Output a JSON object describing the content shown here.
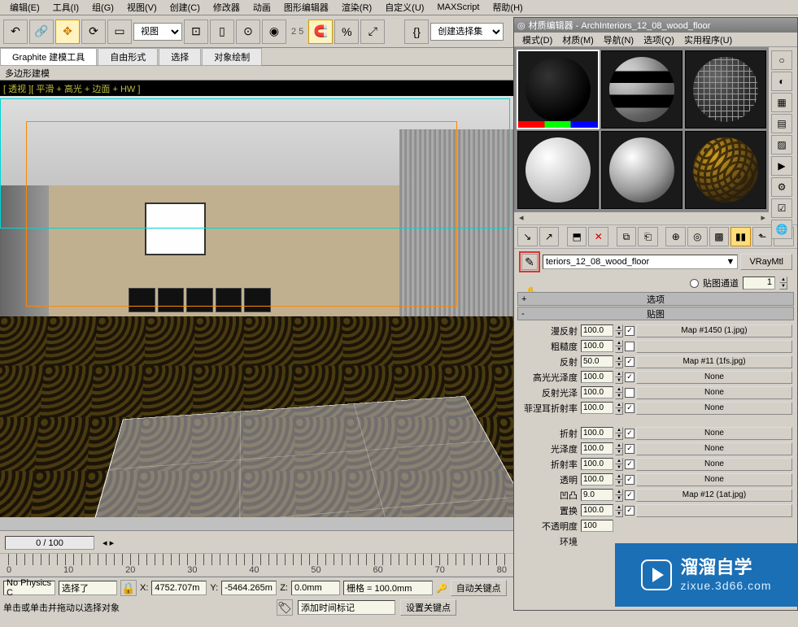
{
  "menus": {
    "m0": "编辑(E)",
    "m1": "工具(I)",
    "m2": "组(G)",
    "m3": "视图(V)",
    "m4": "创建(C)",
    "m5": "修改器",
    "m6": "动画",
    "m7": "图形编辑器",
    "m8": "渲染(R)",
    "m9": "自定义(U)",
    "m10": "MAXScript",
    "m11": "帮助(H)"
  },
  "toolbar": {
    "viewmode": "视图",
    "snap_val": "2 5",
    "create_set": "创建选择集"
  },
  "ribbon": {
    "t0": "Graphite 建模工具",
    "t1": "自由形式",
    "t2": "选择",
    "t3": "对象绘制"
  },
  "sub_ribbon": "多边形建模",
  "viewport": {
    "label": "[ 透视 ][ 平滑 + 高光 + 边面 + HW ]"
  },
  "timeline": {
    "range": "0 / 100",
    "r0": "0",
    "r1": "10",
    "r2": "20",
    "r3": "30",
    "r4": "40",
    "r5": "50",
    "r6": "60",
    "r7": "70",
    "r8": "80"
  },
  "status": {
    "physics": "No Physics C",
    "sel": "选择了",
    "x_lbl": "X:",
    "x": "4752.707m",
    "y_lbl": "Y:",
    "y": "-5464.265m",
    "z_lbl": "Z:",
    "z": "0.0mm",
    "grid": "栅格 = 100.0mm",
    "autokey": "自动关键点",
    "hint": "单击或单击并拖动以选择对象",
    "add_tag": "添加时间标记",
    "setkey": "设置关键点"
  },
  "mat": {
    "title": "材质编辑器 - ArchInteriors_12_08_wood_floor",
    "menu": {
      "m0": "模式(D)",
      "m1": "材质(M)",
      "m2": "导航(N)",
      "m3": "选项(Q)",
      "m4": "实用程序(U)"
    },
    "name": "teriors_12_08_wood_floor",
    "type": "VRayMtl",
    "channel_lbl": "贴图通道",
    "channel_val": "1",
    "roll_options": "选项",
    "roll_maps": "贴图",
    "rows": {
      "diffuse": {
        "lbl": "漫反射",
        "val": "100.0",
        "chk": "✓",
        "map": "Map #1450 (1.jpg)"
      },
      "rough": {
        "lbl": "粗糙度",
        "val": "100.0",
        "chk": "",
        "map": ""
      },
      "reflect": {
        "lbl": "反射",
        "val": "50.0",
        "chk": "✓",
        "map": "Map #11 (1fs.jpg)"
      },
      "hilight": {
        "lbl": "高光光泽度",
        "val": "100.0",
        "chk": "✓",
        "map": "None"
      },
      "rgloss": {
        "lbl": "反射光泽",
        "val": "100.0",
        "chk": "",
        "map": "None"
      },
      "fresnel": {
        "lbl": "菲涅耳折射率",
        "val": "100.0",
        "chk": "✓",
        "map": "None"
      },
      "refract": {
        "lbl": "折射",
        "val": "100.0",
        "chk": "✓",
        "map": "None"
      },
      "gloss": {
        "lbl": "光泽度",
        "val": "100.0",
        "chk": "✓",
        "map": "None"
      },
      "ior": {
        "lbl": "折射率",
        "val": "100.0",
        "chk": "✓",
        "map": "None"
      },
      "transp": {
        "lbl": "透明",
        "val": "100.0",
        "chk": "✓",
        "map": "None"
      },
      "bump": {
        "lbl": "凹凸",
        "val": "9.0",
        "chk": "✓",
        "map": "Map #12 (1at.jpg)"
      },
      "displace": {
        "lbl": "置换",
        "val": "100.0",
        "chk": "✓",
        "map": ""
      },
      "opacity": {
        "lbl": "不透明度",
        "val": "100",
        "chk": "",
        "map": ""
      },
      "env": {
        "lbl": "环境",
        "val": "",
        "chk": "",
        "map": ""
      }
    }
  },
  "wm": {
    "brand": "溜溜自学",
    "domain": "zixue.3d66.com"
  }
}
